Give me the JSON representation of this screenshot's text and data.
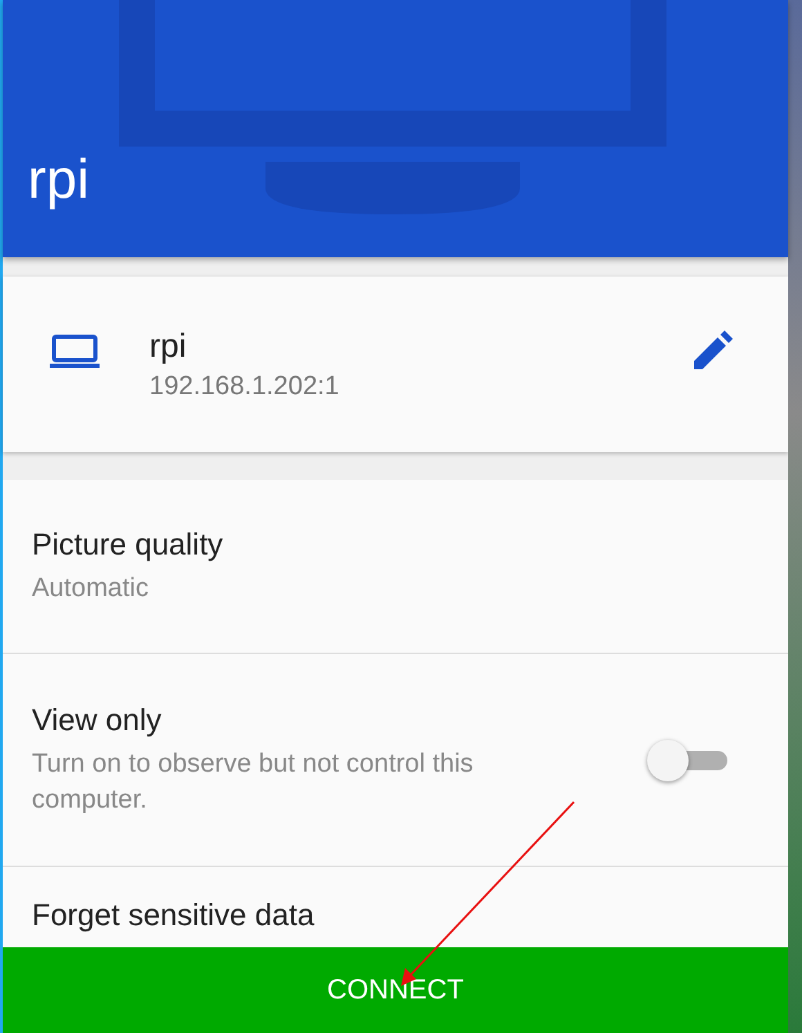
{
  "header": {
    "title": "rpi"
  },
  "host": {
    "name": "rpi",
    "address": "192.168.1.202:1"
  },
  "settings": [
    {
      "kind": "value",
      "label": "Picture quality",
      "value": "Automatic"
    },
    {
      "kind": "toggle",
      "label": "View only",
      "description": "Turn on to observe but not control this computer.",
      "on": false
    },
    {
      "kind": "plain",
      "label": "Forget sensitive data"
    }
  ],
  "connect_button": {
    "label": "CONNECT"
  }
}
